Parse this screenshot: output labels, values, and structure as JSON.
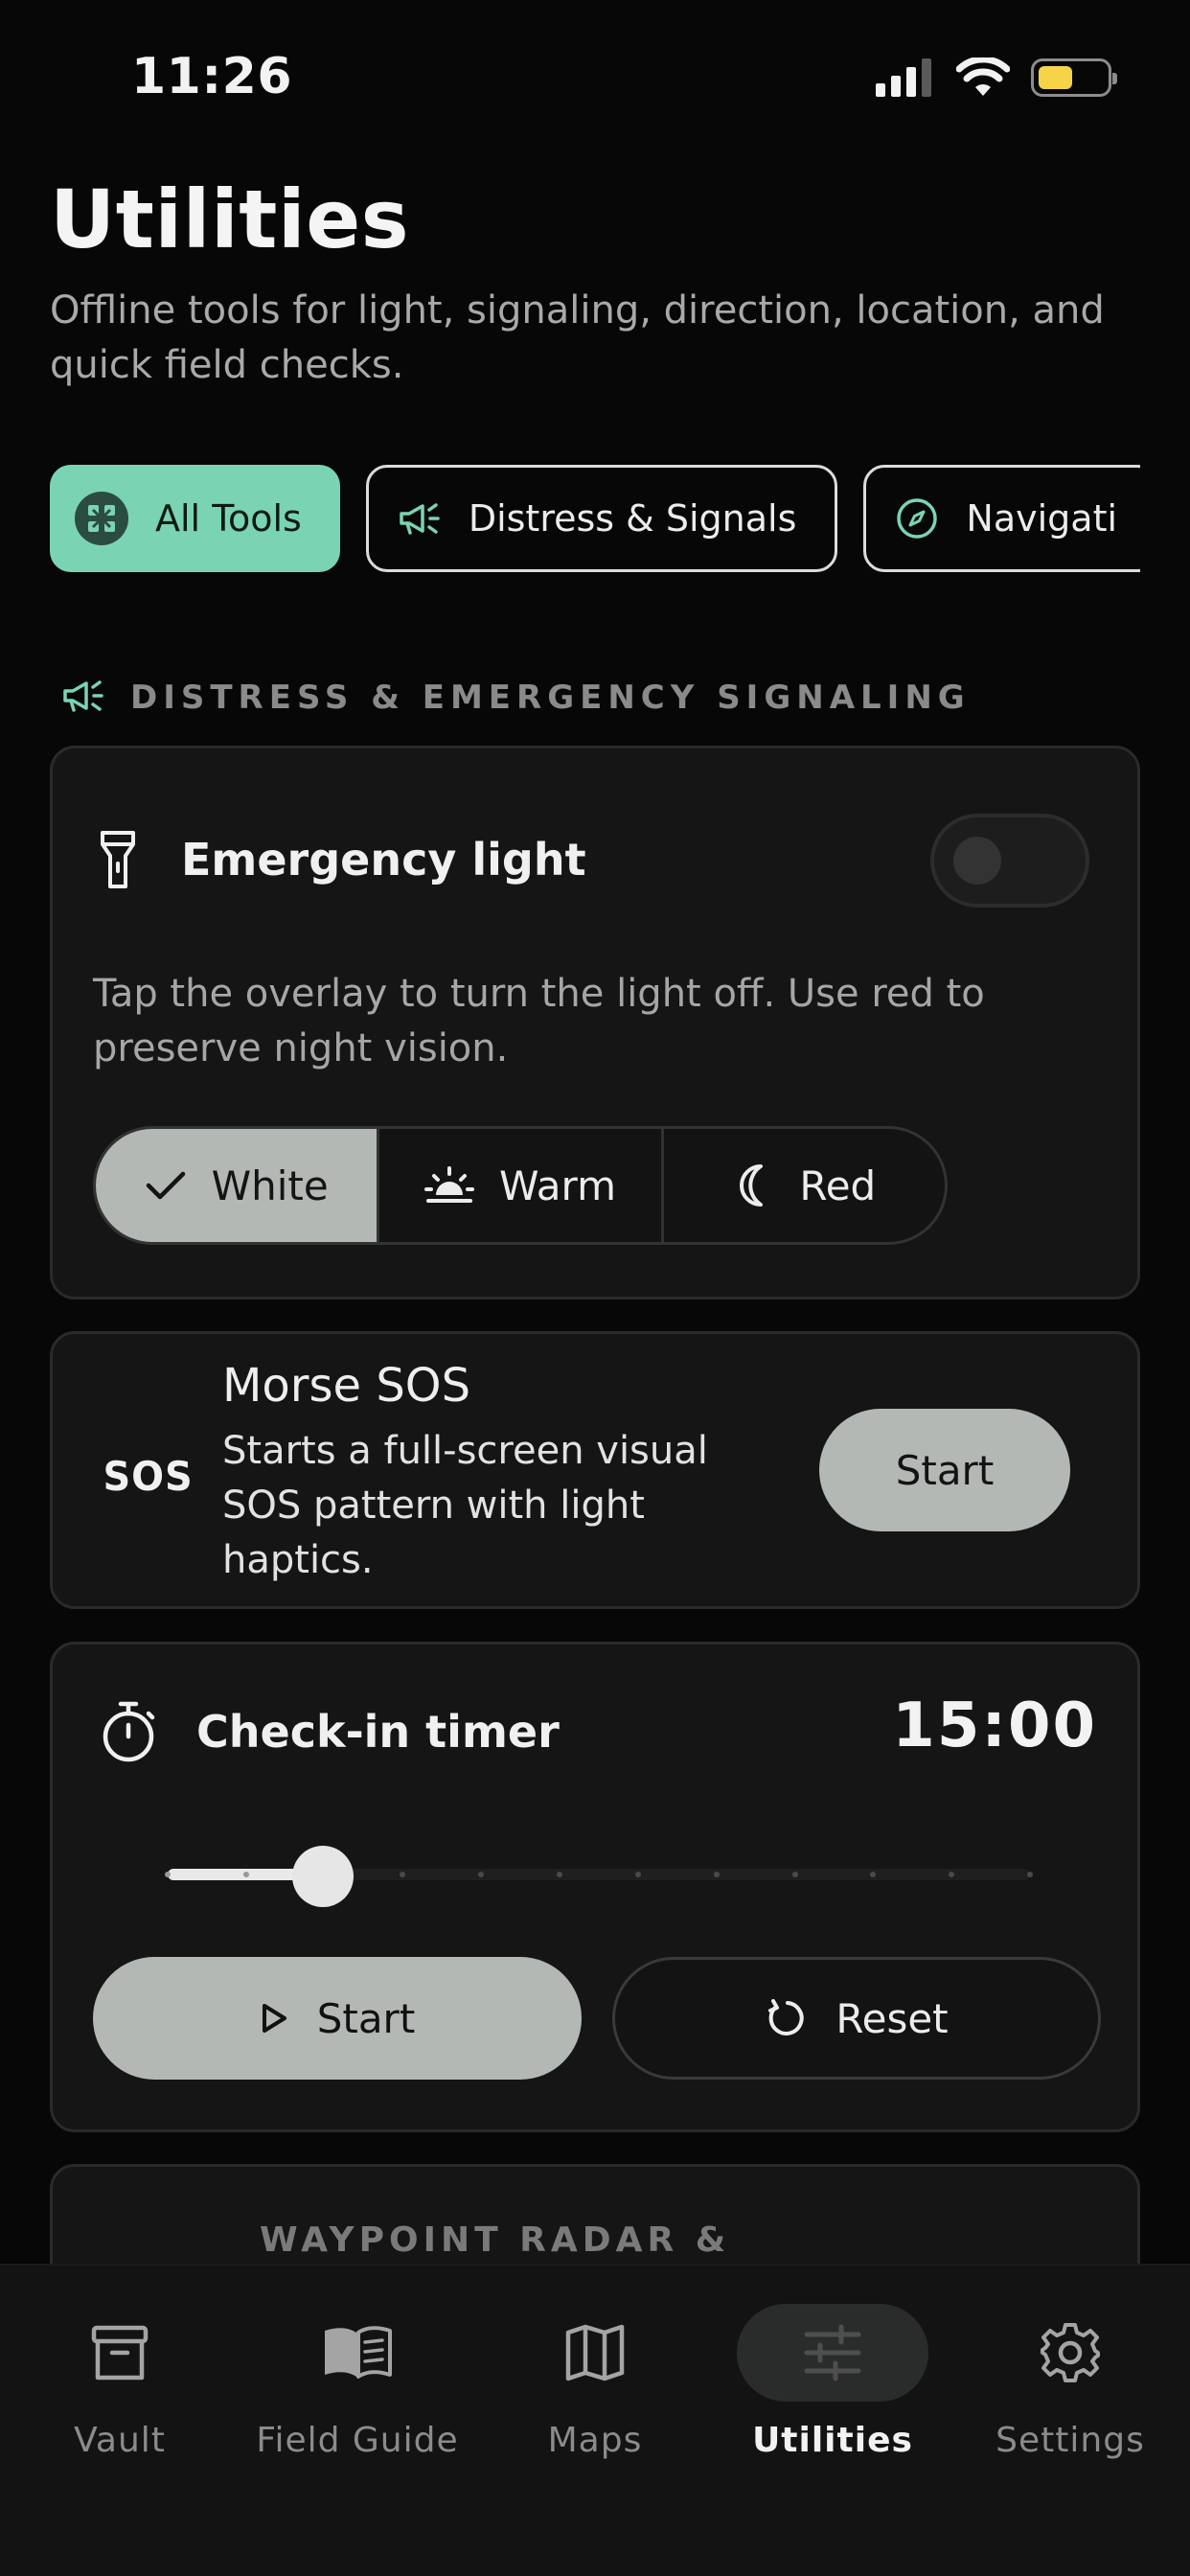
{
  "status_bar": {
    "time": "11:26"
  },
  "header": {
    "title": "Utilities",
    "subtitle": "Offline tools for light, signaling, direction, location, and quick field checks."
  },
  "chips": [
    {
      "label": "All Tools",
      "icon": "grid-icon",
      "active": true
    },
    {
      "label": "Distress & Signals",
      "icon": "megaphone-icon",
      "active": false
    },
    {
      "label": "Navigati",
      "icon": "compass-icon",
      "active": false
    }
  ],
  "section": {
    "title": "DISTRESS & EMERGENCY SIGNALING",
    "icon": "megaphone-icon"
  },
  "emergency_light": {
    "title": "Emergency light",
    "description": "Tap the overlay to turn the light off. Use red to preserve night vision.",
    "toggle_on": false,
    "modes": [
      {
        "label": "White",
        "icon": "check-icon",
        "selected": true
      },
      {
        "label": "Warm",
        "icon": "sunrise-icon",
        "selected": false
      },
      {
        "label": "Red",
        "icon": "moon-icon",
        "selected": false
      }
    ]
  },
  "morse_sos": {
    "logo": "SOS",
    "title": "Morse SOS",
    "description": "Starts a full-screen visual SOS pattern with light haptics.",
    "start_label": "Start"
  },
  "checkin_timer": {
    "title": "Check-in timer",
    "value": "15:00",
    "slider_position": 0.18,
    "slider_stops": 12,
    "start_label": "Start",
    "reset_label": "Reset"
  },
  "next_section": {
    "title": "WAYPOINT RADAR &"
  },
  "tab_bar": {
    "items": [
      {
        "label": "Vault",
        "icon": "archive-icon",
        "active": false
      },
      {
        "label": "Field Guide",
        "icon": "book-icon",
        "active": false
      },
      {
        "label": "Maps",
        "icon": "map-icon",
        "active": false
      },
      {
        "label": "Utilities",
        "icon": "sliders-icon",
        "active": true
      },
      {
        "label": "Settings",
        "icon": "gear-icon",
        "active": false
      }
    ]
  },
  "colors": {
    "accent": "#7ad4b3",
    "background": "#070707",
    "card": "#151515",
    "button_fill": "#b4b8b5",
    "battery": "#f5d547"
  }
}
